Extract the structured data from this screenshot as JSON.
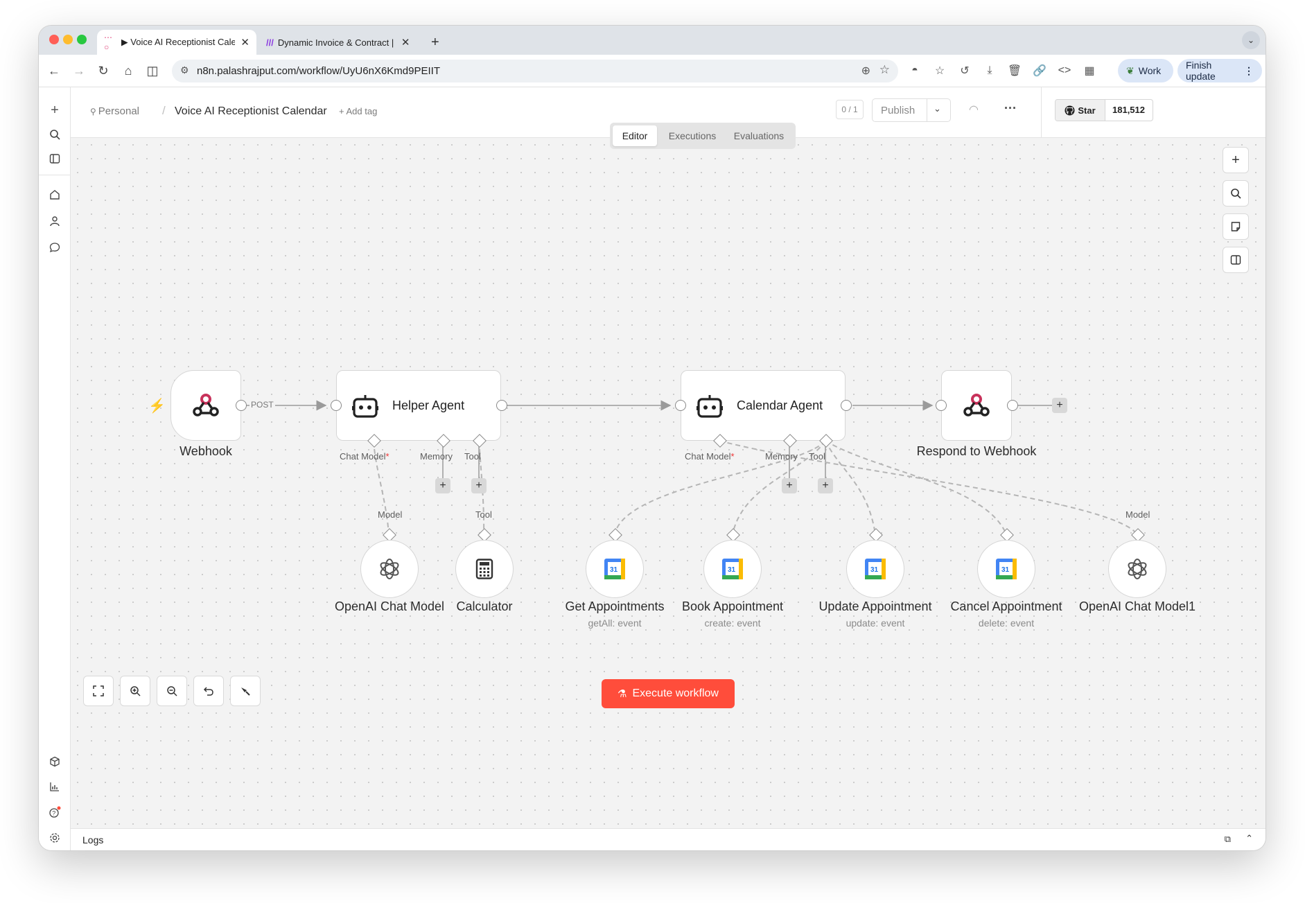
{
  "browser": {
    "tabs": [
      {
        "title": "▶ Voice AI Receptionist Calen"
      },
      {
        "title": "Dynamic Invoice & Contract |"
      }
    ],
    "url": "n8n.palashrajput.com/workflow/UyU6nX6Kmd9PEIIT",
    "profile_label": "Work",
    "update_label": "Finish update"
  },
  "header": {
    "breadcrumb_owner": "Personal",
    "breadcrumb_sep": "/",
    "workflow_name": "Voice AI Receptionist Calendar",
    "add_tag": "+ Add tag",
    "counter": "0 / 1",
    "publish_label": "Publish",
    "star_label": "Star",
    "star_count": "181,512"
  },
  "view_tabs": {
    "editor": "Editor",
    "executions": "Executions",
    "evaluations": "Evaluations"
  },
  "nodes": {
    "webhook": {
      "label": "Webhook",
      "method": "POST"
    },
    "helper_agent": {
      "label": "Helper Agent",
      "port_chat_model": "Chat Model",
      "port_memory": "Memory",
      "port_tool": "Tool"
    },
    "calendar_agent": {
      "label": "Calendar Agent",
      "port_chat_model": "Chat Model",
      "port_memory": "Memory",
      "port_tool": "Tool"
    },
    "respond": {
      "label": "Respond to Webhook"
    },
    "openai1": {
      "label": "OpenAI Chat Model",
      "port": "Model"
    },
    "calculator": {
      "label": "Calculator",
      "port": "Tool"
    },
    "get_appt": {
      "label": "Get Appointments",
      "sub": "getAll: event"
    },
    "book_appt": {
      "label": "Book Appointment",
      "sub": "create: event"
    },
    "update_appt": {
      "label": "Update Appointment",
      "sub": "update: event"
    },
    "cancel_appt": {
      "label": "Cancel Appointment",
      "sub": "delete: event"
    },
    "openai2": {
      "label": "OpenAI Chat Model1",
      "port": "Model"
    },
    "required_mark": "*",
    "calendar_badge": "31"
  },
  "execute_label": "Execute workflow",
  "logs_label": "Logs",
  "colors": {
    "accent": "#ff4d3b",
    "webhook": "#c8325b"
  }
}
